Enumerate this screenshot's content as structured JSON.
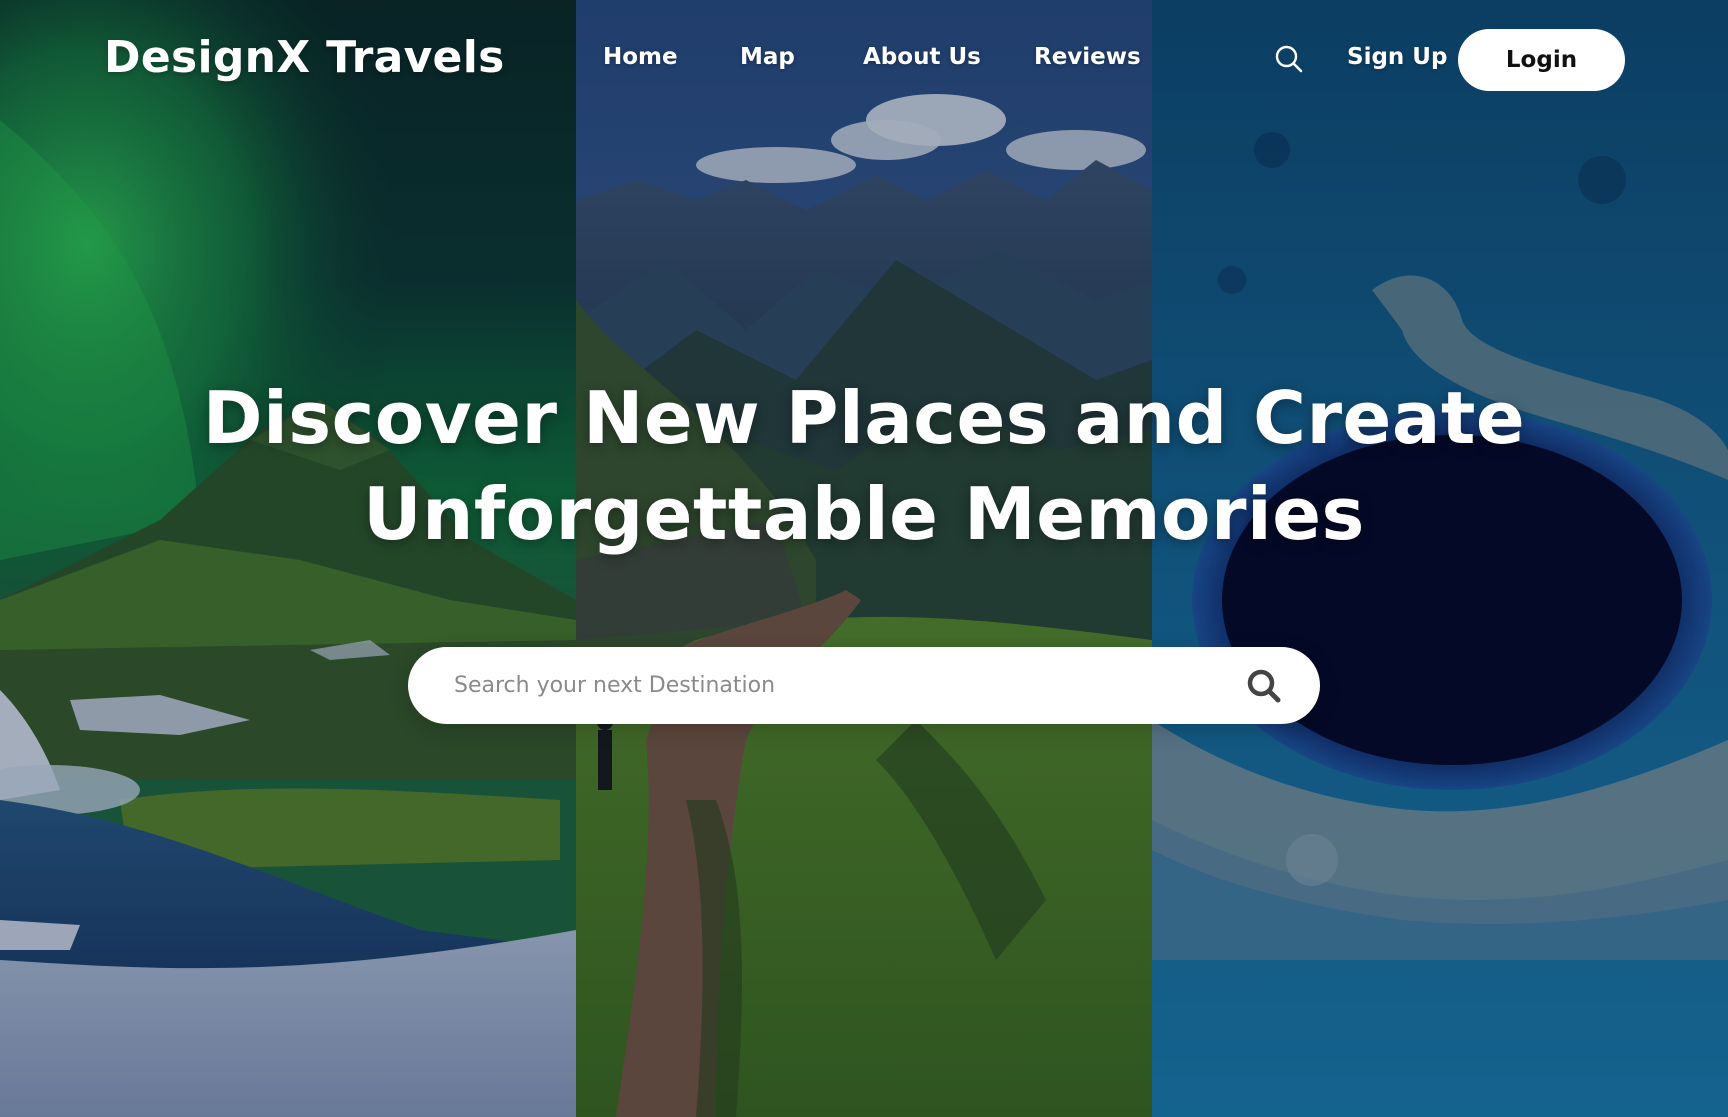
{
  "brand": {
    "name": "DesignX Travels"
  },
  "nav": {
    "items": [
      {
        "label": "Home"
      },
      {
        "label": "Map"
      },
      {
        "label": "About Us"
      },
      {
        "label": "Reviews"
      }
    ]
  },
  "header": {
    "search_icon": "search-icon",
    "signup_label": "Sign Up",
    "login_label": "Login"
  },
  "hero": {
    "title_line1": "Discover New Places and Create",
    "title_line2": "Unforgettable Memories"
  },
  "search": {
    "placeholder": "Search your next Destination",
    "icon": "search-icon"
  },
  "colors": {
    "text_light": "#ffffff",
    "button_bg": "#ffffff",
    "button_text": "#111111",
    "placeholder": "#8a8a8a"
  }
}
